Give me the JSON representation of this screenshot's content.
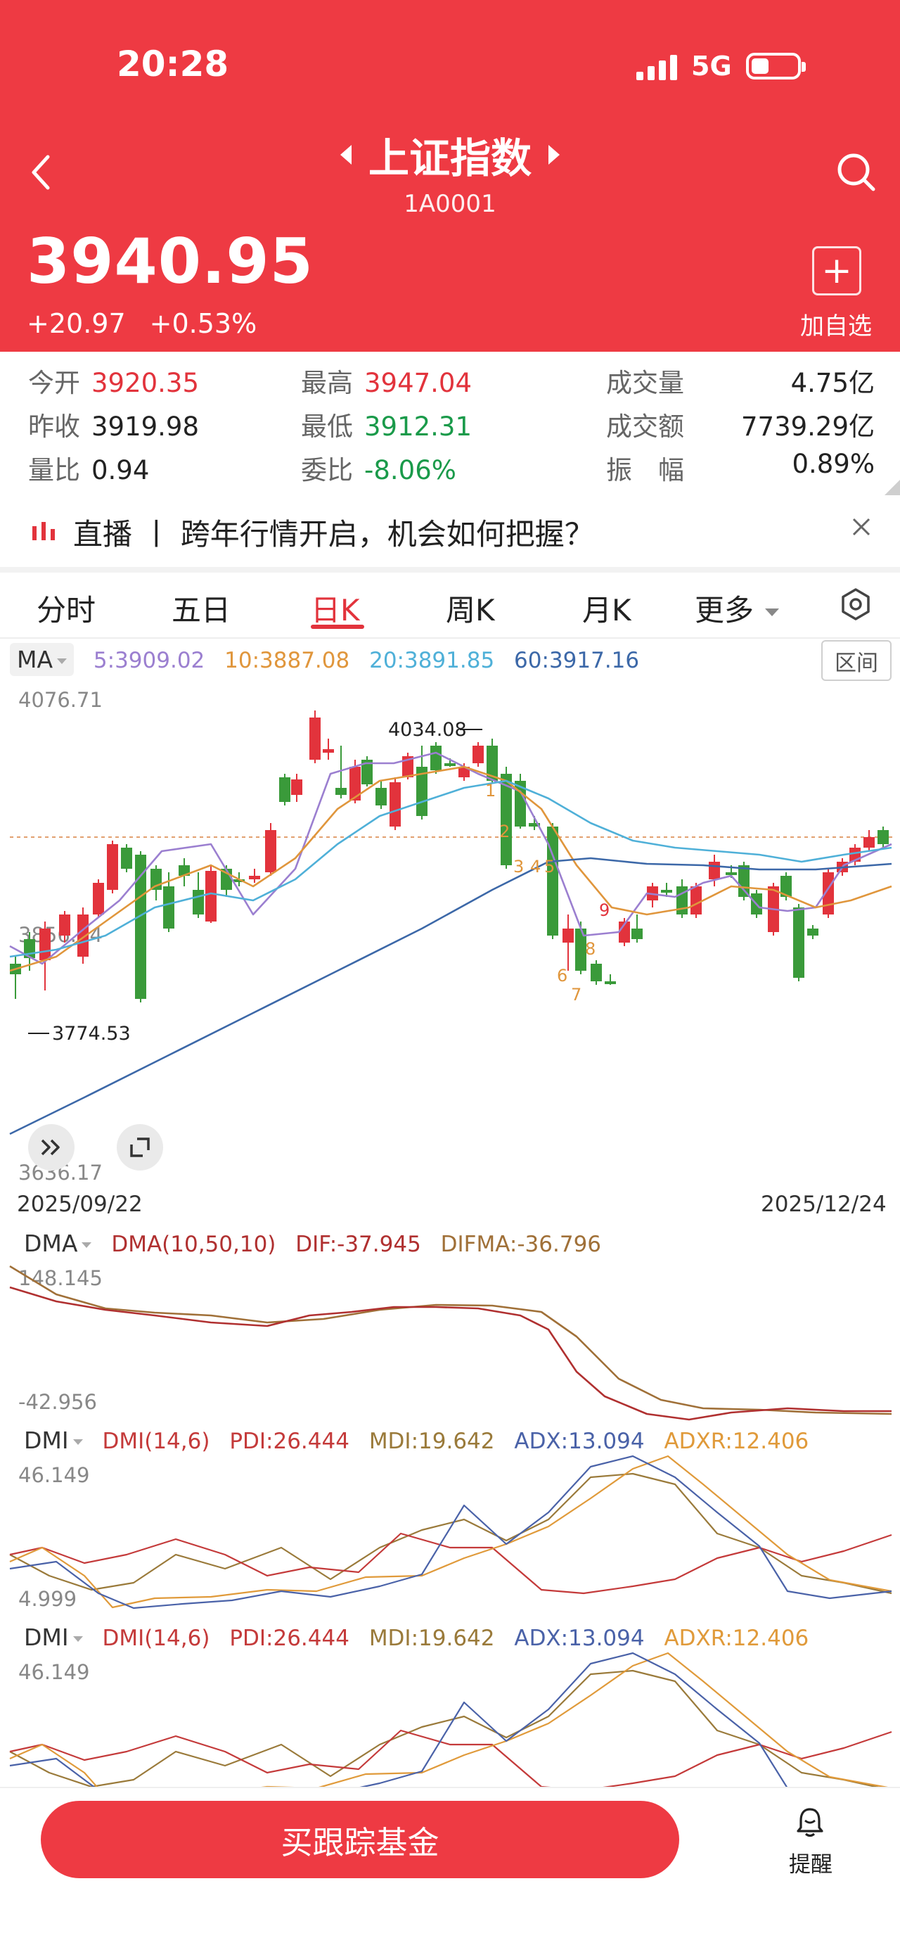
{
  "status_bar": {
    "time": "20:28",
    "network": "5G"
  },
  "header": {
    "title": "上证指数",
    "code": "1A0001",
    "price": "3940.95",
    "change": "+20.97",
    "change_pct": "+0.53%",
    "add_label": "加自选",
    "add_symbol": "+"
  },
  "stats": {
    "open": {
      "label": "今开",
      "value": "3920.35"
    },
    "prev": {
      "label": "昨收",
      "value": "3919.98"
    },
    "ratio": {
      "label": "量比",
      "value": "0.94"
    },
    "high": {
      "label": "最高",
      "value": "3947.04"
    },
    "low": {
      "label": "最低",
      "value": "3912.31"
    },
    "commit": {
      "label": "委比",
      "value": "-8.06%"
    },
    "volume": {
      "label": "成交量",
      "value": "4.75亿"
    },
    "amount": {
      "label": "成交额",
      "value": "7739.29亿"
    },
    "amp": {
      "label": "振　幅",
      "value": "0.89%"
    }
  },
  "live": {
    "text": "直播 丨 跨年行情开启，机会如何把握？"
  },
  "tabs": [
    {
      "label": "分时"
    },
    {
      "label": "五日"
    },
    {
      "label": "日K"
    },
    {
      "label": "周K"
    },
    {
      "label": "月K"
    },
    {
      "label": "更多"
    }
  ],
  "ma": {
    "key": "MA",
    "ma5": "5:3909.02",
    "ma10": "10:3887.08",
    "ma20": "20:3891.85",
    "ma60": "60:3917.16",
    "range_btn": "区间",
    "colors": {
      "ma5": "#9b7fd0",
      "ma10": "#e0963c",
      "ma20": "#4fb0d8",
      "ma60": "#3c68a8",
      "up": "#e2333c",
      "down": "#3a9a3a"
    }
  },
  "kline": {
    "y_top": "4076.71",
    "y_mid": "3856.44",
    "y_bottom": "3636.17",
    "max_label": "4034.08",
    "min_label": "3774.53",
    "date_start": "2025/09/22",
    "date_end": "2025/12/24"
  },
  "sequence_labels": [
    "1",
    "2",
    "3",
    "4",
    "5",
    "6",
    "7",
    "8",
    "9"
  ],
  "dma": {
    "key": "DMA",
    "params": "DMA(10,50,10)",
    "dif": "DIF:-37.945",
    "difma": "DIFMA:-36.796",
    "y_top": "148.145",
    "y_bottom": "-42.956"
  },
  "dmi": {
    "key": "DMI",
    "params": "DMI(14,6)",
    "pdi": "PDI:26.444",
    "mdi": "MDI:19.642",
    "adx": "ADX:13.094",
    "adxr": "ADXR:12.406",
    "y_top": "46.149",
    "y_bottom": "4.999"
  },
  "bottom": {
    "buy": "买跟踪基金",
    "remind": "提醒"
  }
}
